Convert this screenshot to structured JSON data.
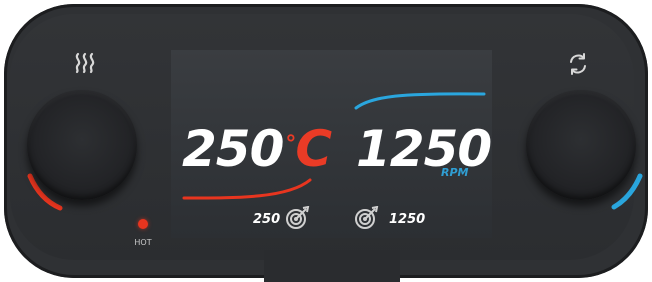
{
  "display": {
    "temperature": {
      "value": "250",
      "unit_degree": "°",
      "unit_letter": "C",
      "target": "250"
    },
    "speed": {
      "value": "1250",
      "unit": "RPM",
      "target": "1250"
    }
  },
  "indicators": {
    "hot_label": "HOT"
  },
  "icons": {
    "heat": "heat-waves-icon",
    "rotate": "rotate-icon",
    "temp_target": "target-icon",
    "speed_target": "target-icon"
  },
  "colors": {
    "body": "#2f3134",
    "screen": "#34373b",
    "temperature_accent": "#ea3b26",
    "speed_accent": "#2f9ed3",
    "text": "#ffffff"
  }
}
